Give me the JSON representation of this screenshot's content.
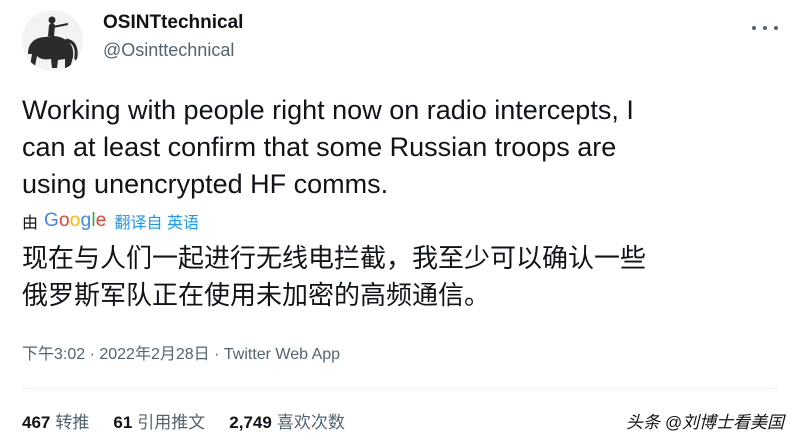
{
  "author": {
    "display_name": "OSINTtechnical",
    "handle": "@Osinttechnical"
  },
  "tweet": {
    "text_en_lines": [
      "Working with people right now on radio intercepts, I",
      "can at least confirm that some Russian troops are",
      "using unencrypted HF comms."
    ],
    "translation": {
      "by_label": "由",
      "provider": "Google",
      "link_text": "翻译自 英语"
    },
    "text_zh_lines": [
      "现在与人们一起进行无线电拦截，我至少可以确认一些",
      "俄罗斯军队正在使用未加密的高频通信。"
    ],
    "meta": "下午3:02 · 2022年2月28日 · Twitter Web App"
  },
  "stats": {
    "retweets_count": "467",
    "retweets_label": "转推",
    "quotes_count": "61",
    "quotes_label": "引用推文",
    "likes_count": "2,749",
    "likes_label": "喜欢次数"
  },
  "watermark": "头条 @刘博士看美国",
  "icons": {
    "more": "more-icon",
    "avatar": "avatar"
  },
  "colors": {
    "text_primary": "#0f1419",
    "text_secondary": "#536471",
    "link": "#1d9bf0",
    "divider": "#eff3f4"
  }
}
